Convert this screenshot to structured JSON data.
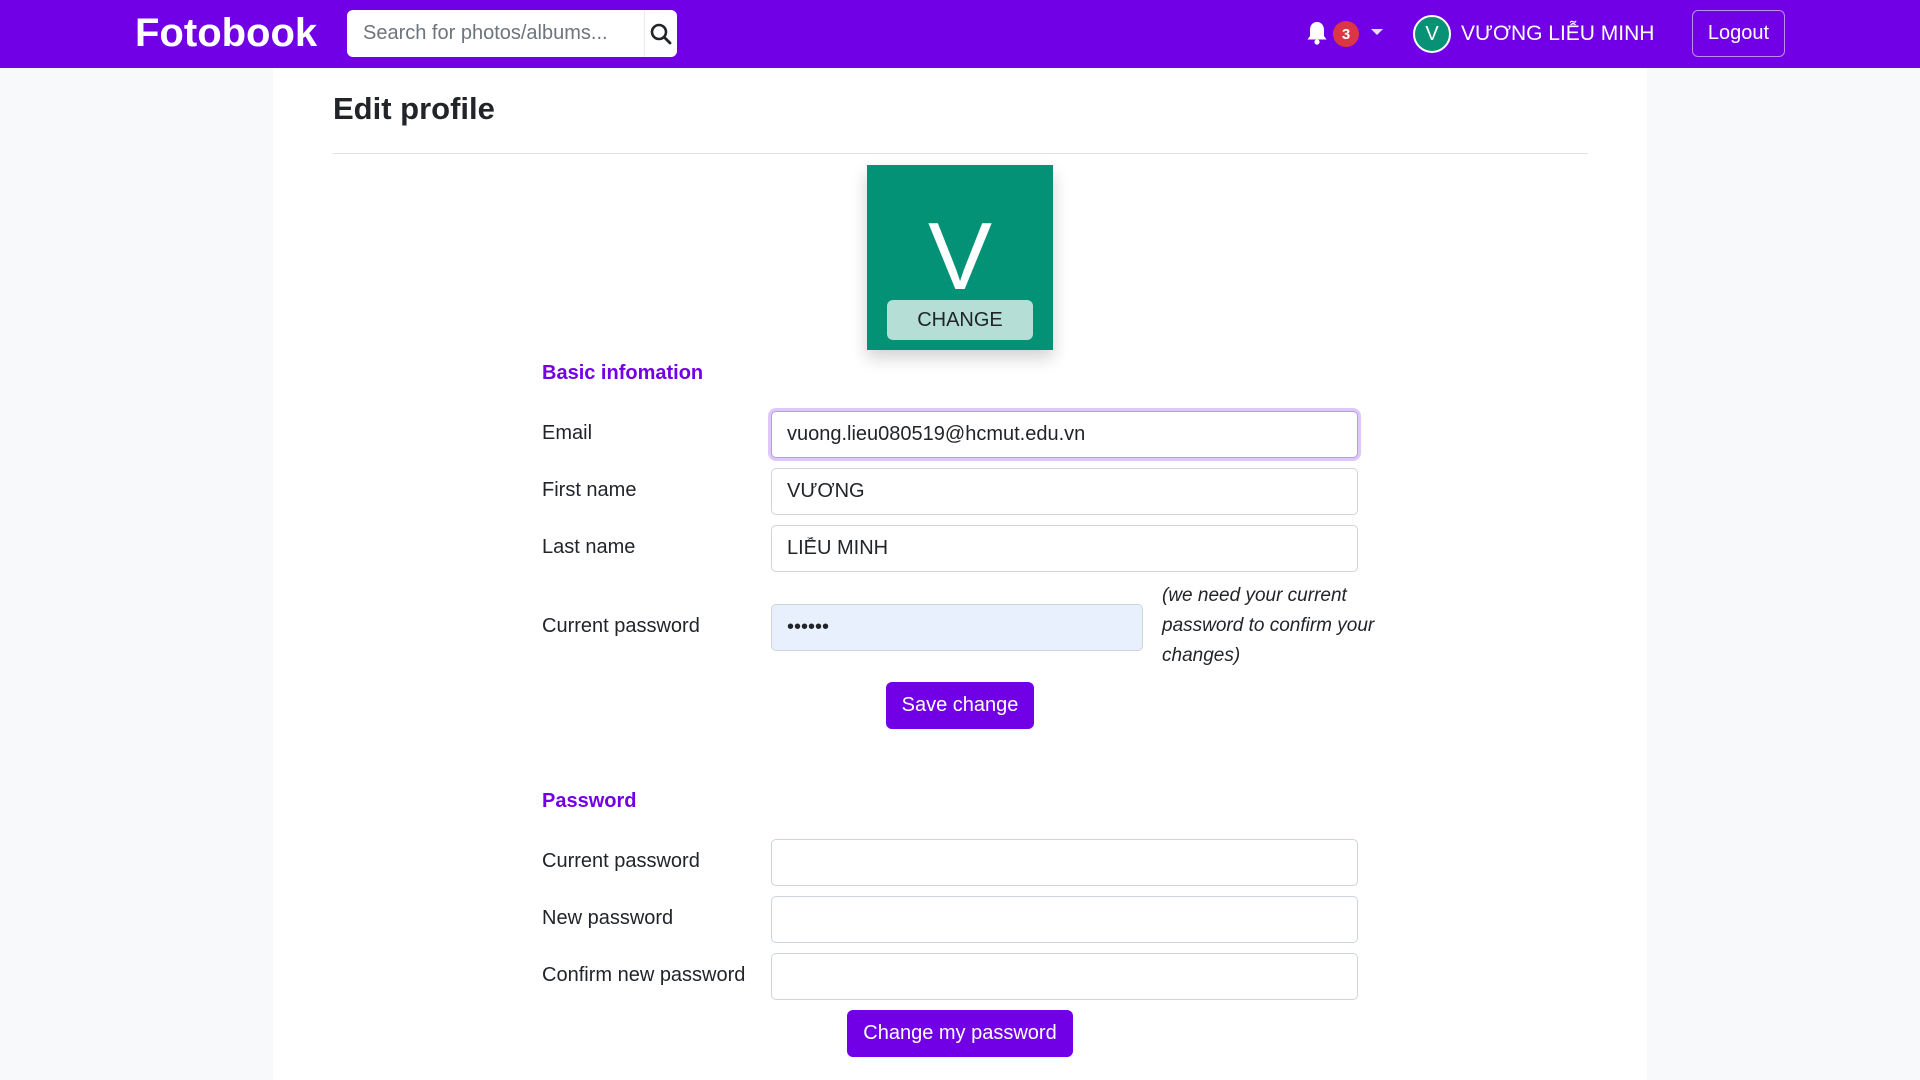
{
  "navbar": {
    "brand": "Fotobook",
    "search_placeholder": "Search for photos/albums...",
    "notification_count": "3",
    "user_initial": "V",
    "user_name": "VƯƠNG LIỄU MINH",
    "logout_label": "Logout"
  },
  "page": {
    "title": "Edit profile"
  },
  "avatar": {
    "letter": "V",
    "change_label": "CHANGE",
    "color": "#049277"
  },
  "basic_info": {
    "title": "Basic infomation",
    "email_label": "Email",
    "email_value": "vuong.lieu080519@hcmut.edu.vn",
    "first_name_label": "First name",
    "first_name_value": "VƯƠNG",
    "last_name_label": "Last name",
    "last_name_value": "LIỄU MINH",
    "current_password_label": "Current password",
    "current_password_value": "••••••",
    "hint": "(we need your current password to confirm your changes)",
    "save_label": "Save change"
  },
  "password": {
    "title": "Password",
    "current_label": "Current password",
    "new_label": "New password",
    "confirm_label": "Confirm new password",
    "submit_label": "Change my password"
  },
  "colors": {
    "accent": "#7200e6",
    "badge": "#dc3545",
    "avatar": "#049277"
  }
}
